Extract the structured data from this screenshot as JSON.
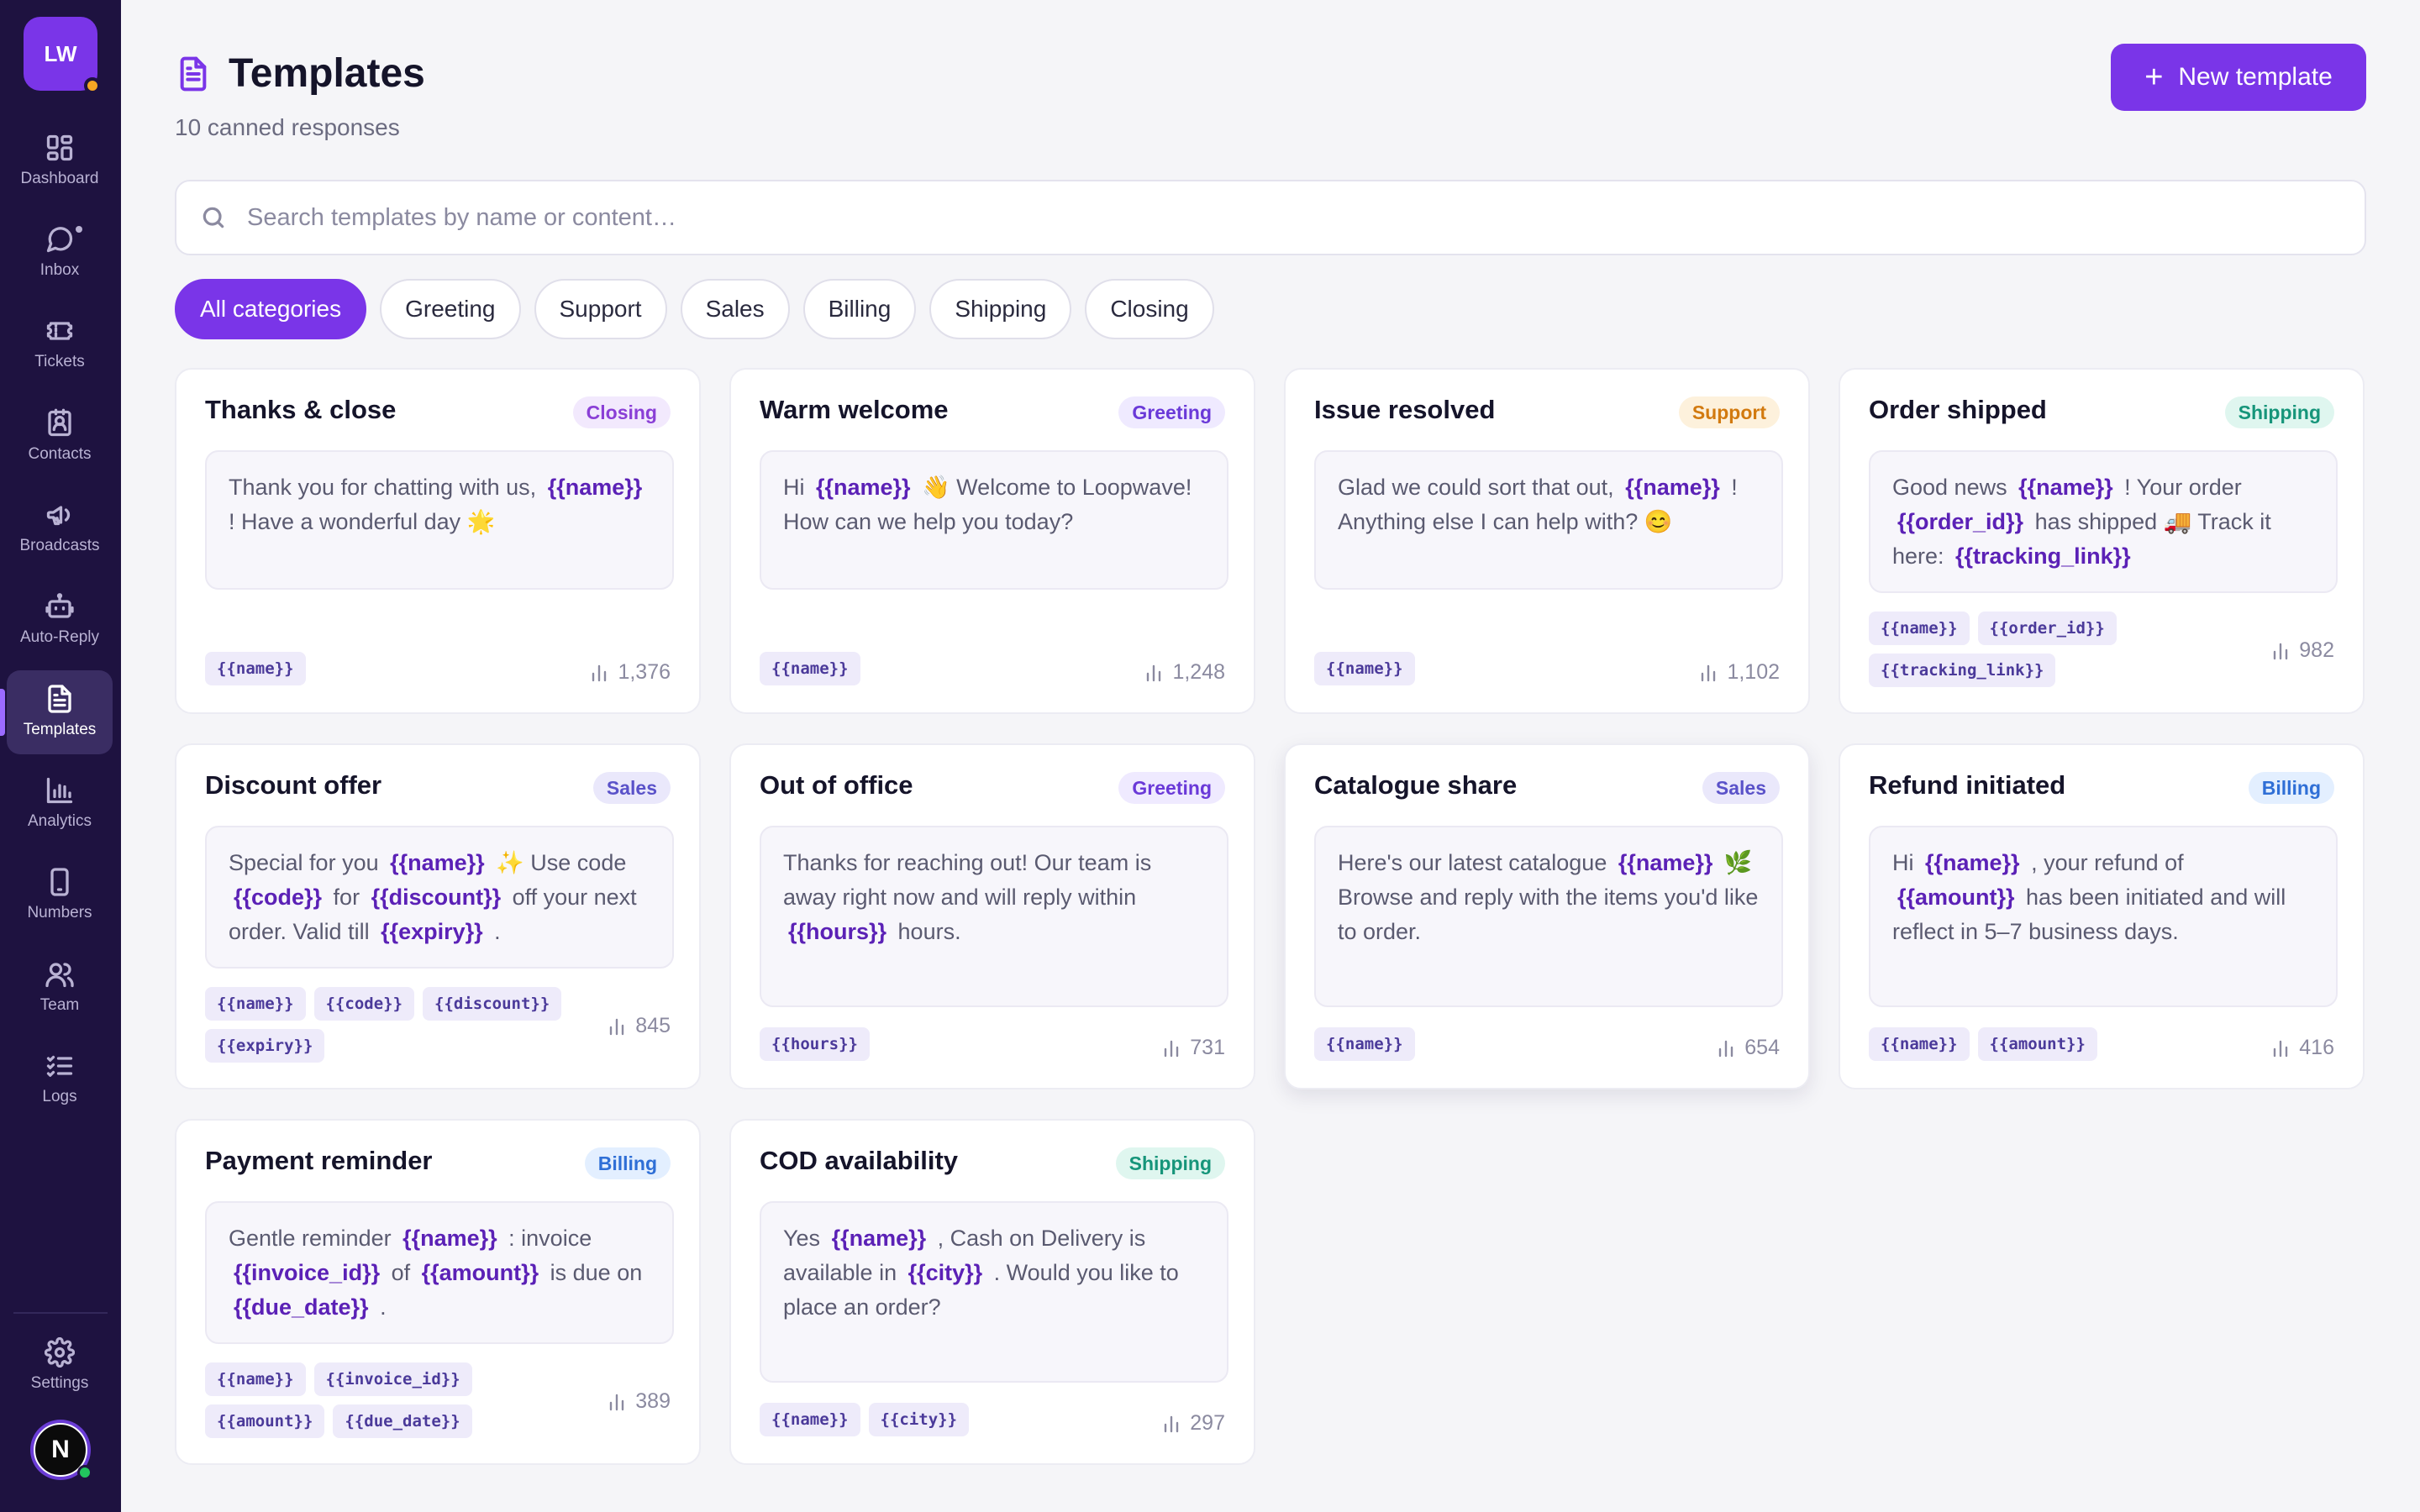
{
  "brand": {
    "initials": "LW"
  },
  "nav": [
    {
      "label": "Dashboard",
      "icon": "grid-icon"
    },
    {
      "label": "Inbox",
      "icon": "chat-icon"
    },
    {
      "label": "Tickets",
      "icon": "ticket-icon"
    },
    {
      "label": "Contacts",
      "icon": "contact-card-icon"
    },
    {
      "label": "Broadcasts",
      "icon": "megaphone-icon"
    },
    {
      "label": "Auto-Reply",
      "icon": "bot-icon"
    },
    {
      "label": "Templates",
      "icon": "document-icon",
      "active": true
    },
    {
      "label": "Analytics",
      "icon": "bar-chart-icon"
    },
    {
      "label": "Numbers",
      "icon": "phone-icon"
    },
    {
      "label": "Team",
      "icon": "users-icon"
    },
    {
      "label": "Logs",
      "icon": "list-check-icon"
    }
  ],
  "settings": {
    "label": "Settings",
    "icon": "gear-icon"
  },
  "user": {
    "initial": "N"
  },
  "header": {
    "title": "Templates",
    "subtitle": "10 canned responses",
    "new_button": "New template"
  },
  "search": {
    "placeholder": "Search templates by name or content…"
  },
  "filters": [
    "All categories",
    "Greeting",
    "Support",
    "Sales",
    "Billing",
    "Shipping",
    "Closing"
  ],
  "active_filter": "All categories",
  "colors": {
    "accent": "#7a35e8",
    "sidebar": "#1e1240",
    "background": "#f5f5f8"
  },
  "templates": [
    {
      "title": "Thanks & close",
      "category": "Closing",
      "uses": "1,376",
      "body": [
        {
          "t": "Thank you for chatting with us, "
        },
        {
          "v": "{{name}}"
        },
        {
          "t": " ! Have a wonderful day 🌟"
        }
      ],
      "tags": [
        "{{name}}"
      ]
    },
    {
      "title": "Warm welcome",
      "category": "Greeting",
      "uses": "1,248",
      "body": [
        {
          "t": "Hi "
        },
        {
          "v": "{{name}}"
        },
        {
          "t": " 👋 Welcome to Loopwave! How can we help you today?"
        }
      ],
      "tags": [
        "{{name}}"
      ]
    },
    {
      "title": "Issue resolved",
      "category": "Support",
      "uses": "1,102",
      "body": [
        {
          "t": "Glad we could sort that out, "
        },
        {
          "v": "{{name}}"
        },
        {
          "t": " ! Anything else I can help with? 😊"
        }
      ],
      "tags": [
        "{{name}}"
      ]
    },
    {
      "title": "Order shipped",
      "category": "Shipping",
      "uses": "982",
      "body": [
        {
          "t": "Good news "
        },
        {
          "v": "{{name}}"
        },
        {
          "t": " ! Your order "
        },
        {
          "v": "{{order_id}}"
        },
        {
          "t": " has shipped 🚚 Track it here: "
        },
        {
          "v": "{{tracking_link}}"
        }
      ],
      "tags": [
        "{{name}}",
        "{{order_id}}",
        "{{tracking_link}}"
      ]
    },
    {
      "title": "Discount offer",
      "category": "Sales",
      "uses": "845",
      "body": [
        {
          "t": "Special for you "
        },
        {
          "v": "{{name}}"
        },
        {
          "t": " ✨ Use code "
        },
        {
          "v": "{{code}}"
        },
        {
          "t": " for "
        },
        {
          "v": "{{discount}}"
        },
        {
          "t": " off your next order. Valid till "
        },
        {
          "v": "{{expiry}}"
        },
        {
          "t": " ."
        }
      ],
      "tags": [
        "{{name}}",
        "{{code}}",
        "{{discount}}",
        "{{expiry}}"
      ]
    },
    {
      "title": "Out of office",
      "category": "Greeting",
      "uses": "731",
      "body": [
        {
          "t": "Thanks for reaching out! Our team is away right now and will reply within "
        },
        {
          "v": "{{hours}}"
        },
        {
          "t": " hours."
        }
      ],
      "tags": [
        "{{hours}}"
      ]
    },
    {
      "title": "Catalogue share",
      "category": "Sales",
      "uses": "654",
      "body": [
        {
          "t": "Here's our latest catalogue "
        },
        {
          "v": "{{name}}"
        },
        {
          "t": " 🌿 Browse and reply with the items you'd like to order."
        }
      ],
      "tags": [
        "{{name}}"
      ]
    },
    {
      "title": "Refund initiated",
      "category": "Billing",
      "uses": "416",
      "body": [
        {
          "t": "Hi "
        },
        {
          "v": "{{name}}"
        },
        {
          "t": " , your refund of "
        },
        {
          "v": "{{amount}}"
        },
        {
          "t": " has been initiated and will reflect in 5–7 business days."
        }
      ],
      "tags": [
        "{{name}}",
        "{{amount}}"
      ]
    },
    {
      "title": "Payment reminder",
      "category": "Billing",
      "uses": "389",
      "body": [
        {
          "t": "Gentle reminder "
        },
        {
          "v": "{{name}}"
        },
        {
          "t": " : invoice "
        },
        {
          "v": "{{invoice_id}}"
        },
        {
          "t": " of "
        },
        {
          "v": "{{amount}}"
        },
        {
          "t": " is due on "
        },
        {
          "v": "{{due_date}}"
        },
        {
          "t": " ."
        }
      ],
      "tags": [
        "{{name}}",
        "{{invoice_id}}",
        "{{amount}}",
        "{{due_date}}"
      ]
    },
    {
      "title": "COD availability",
      "category": "Shipping",
      "uses": "297",
      "body": [
        {
          "t": "Yes "
        },
        {
          "v": "{{name}}"
        },
        {
          "t": " , Cash on Delivery is available in "
        },
        {
          "v": "{{city}}"
        },
        {
          "t": " . Would you like to place an order?"
        }
      ],
      "tags": [
        "{{name}}",
        "{{city}}"
      ]
    }
  ]
}
